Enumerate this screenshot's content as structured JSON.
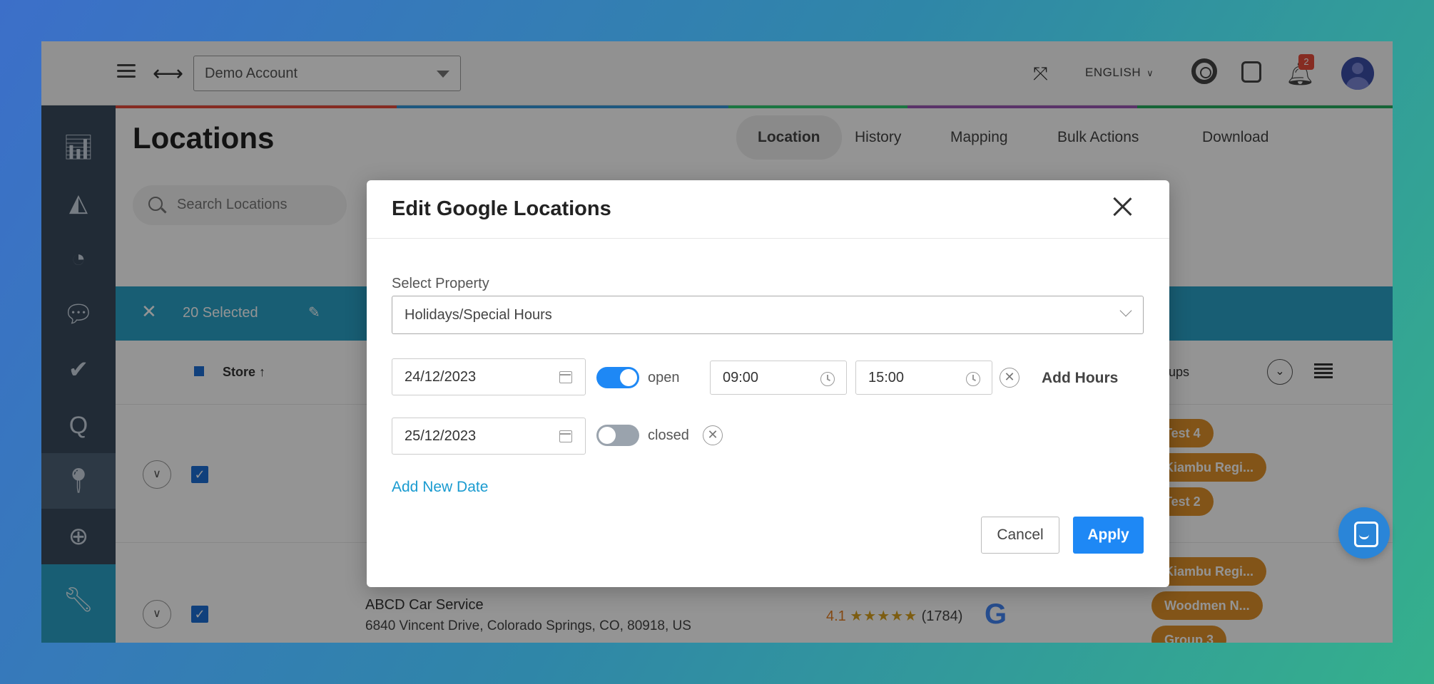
{
  "header": {
    "account": "Demo Account",
    "language": "ENGLISH",
    "notification_count": "2"
  },
  "page": {
    "title": "Locations",
    "tabs": [
      {
        "label": "Location"
      },
      {
        "label": "History"
      },
      {
        "label": "Mapping"
      },
      {
        "label": "Bulk Actions"
      },
      {
        "label": "Download"
      }
    ],
    "search_placeholder": "Search Locations",
    "selected_count": "20 Selected"
  },
  "table": {
    "col_store": "Store",
    "col_groups": "Groups",
    "rows": [
      {
        "name": "",
        "address": "",
        "groups": [
          "Test 4",
          "Kiambu Regi...",
          "Test 2"
        ]
      },
      {
        "name": "ABCD Car Service",
        "address": "6840 Vincent Drive, Colorado Springs, CO, 80918, US",
        "rating": "4.1",
        "stars": "★★★★★",
        "reviews": "(1784)",
        "groups": [
          "Kiambu Regi...",
          "Woodmen N...",
          "Group 3"
        ]
      }
    ]
  },
  "modal": {
    "title": "Edit Google Locations",
    "property_label": "Select Property",
    "property_value": "Holidays/Special Hours",
    "dates": [
      {
        "date": "24/12/2023",
        "status": "open",
        "open_time": "09:00",
        "close_time": "15:00"
      },
      {
        "date": "25/12/2023",
        "status": "closed"
      }
    ],
    "add_hours_label": "Add Hours",
    "add_date_label": "Add New Date",
    "cancel_label": "Cancel",
    "apply_label": "Apply"
  },
  "colors": {
    "accent": "#1e88f5",
    "sidebar": "#3a4b5e",
    "bulk_bar": "#2aa3c8",
    "chip": "#e0922a"
  }
}
